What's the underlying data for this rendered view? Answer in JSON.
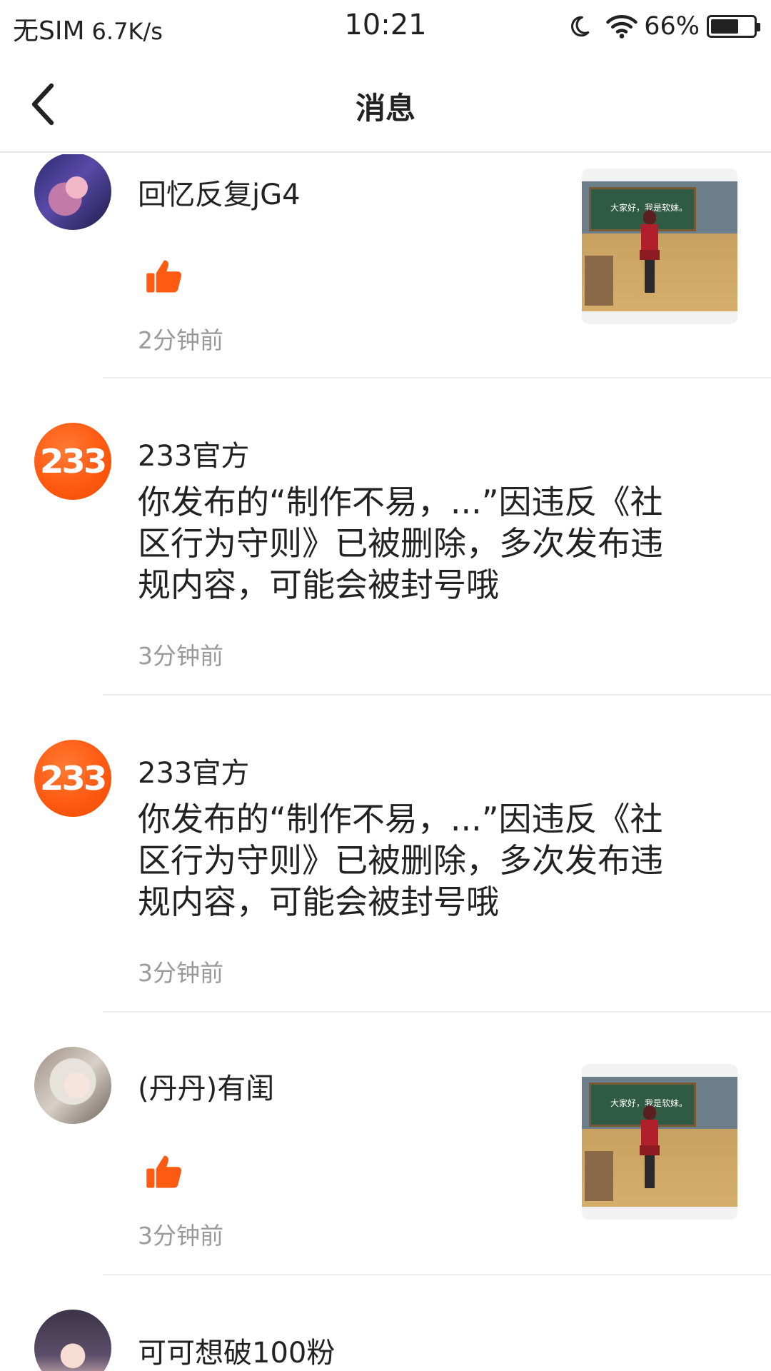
{
  "status_bar": {
    "carrier": "无SIM",
    "speed": "6.7K/s",
    "time": "10:21",
    "battery": "66%",
    "battery_level": 0.66,
    "icons": [
      "moon-icon",
      "wifi-icon",
      "battery-icon"
    ]
  },
  "header": {
    "title": "消息",
    "back_icon": "chevron-left-icon"
  },
  "colors": {
    "accent": "#ff5a12",
    "timestamp": "#9a9a9a",
    "divider": "#ececec"
  },
  "messages": [
    {
      "user": "回忆反复jG4",
      "type": "like",
      "icon": "thumbs-up-icon",
      "time": "2分钟前",
      "has_thumbnail": true
    },
    {
      "user": "233官方",
      "avatar_text": "233",
      "type": "notice",
      "text": "你发布的“制作不易，...”因违反《社区行为守则》已被删除，多次发布违规内容，可能会被封号哦",
      "time": "3分钟前"
    },
    {
      "user": "233官方",
      "avatar_text": "233",
      "type": "notice",
      "text": "你发布的“制作不易，...”因违反《社区行为守则》已被删除，多次发布违规内容，可能会被封号哦",
      "time": "3分钟前"
    },
    {
      "user": "(丹丹)有闺",
      "type": "like",
      "icon": "thumbs-up-icon",
      "time": "3分钟前",
      "has_thumbnail": true
    },
    {
      "user": "可可想破100粉",
      "type": "partial"
    }
  ],
  "thumbnail_caption": "大家好，我是软妹。"
}
